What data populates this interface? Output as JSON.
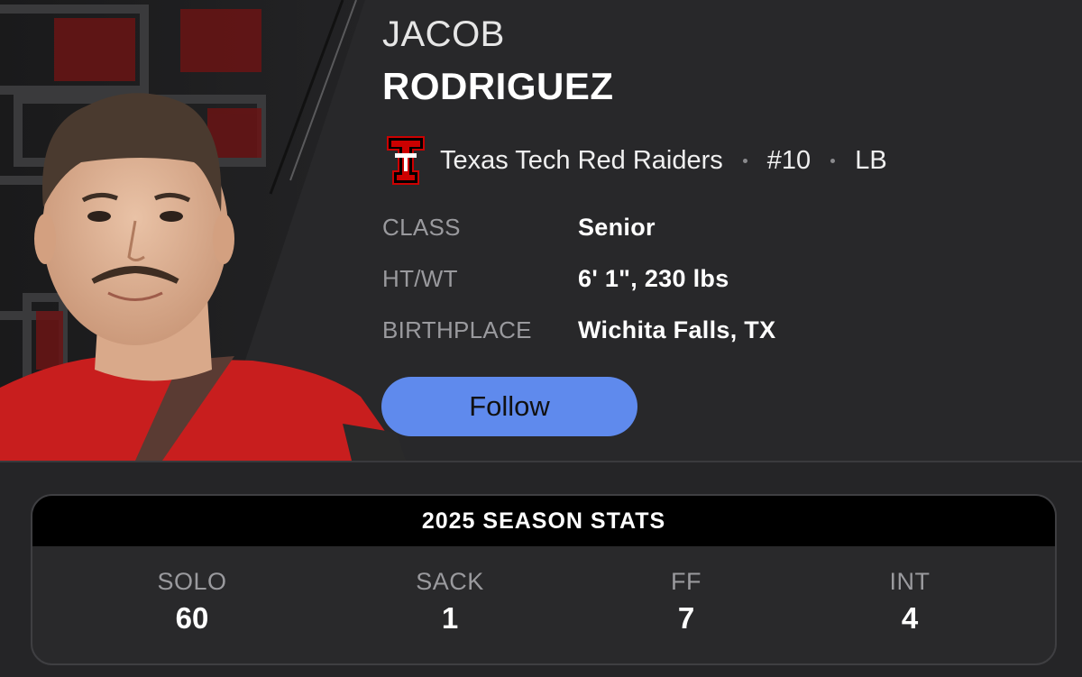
{
  "player": {
    "first_name": "JACOB",
    "last_name": "RODRIGUEZ",
    "team": "Texas Tech Red Raiders",
    "number": "#10",
    "position": "LB",
    "team_logo": "double-t-logo"
  },
  "info": [
    {
      "label": "CLASS",
      "value": "Senior"
    },
    {
      "label": "HT/WT",
      "value": "6' 1\", 230 lbs"
    },
    {
      "label": "BIRTHPLACE",
      "value": "Wichita Falls, TX"
    }
  ],
  "follow_label": "Follow",
  "stats": {
    "title": "2025 SEASON STATS",
    "items": [
      {
        "label": "SOLO",
        "value": "60"
      },
      {
        "label": "SACK",
        "value": "1"
      },
      {
        "label": "FF",
        "value": "7"
      },
      {
        "label": "INT",
        "value": "4"
      }
    ]
  },
  "colors": {
    "accent": "#5f8aed",
    "team_red": "#cc0000",
    "background": "#252527"
  }
}
